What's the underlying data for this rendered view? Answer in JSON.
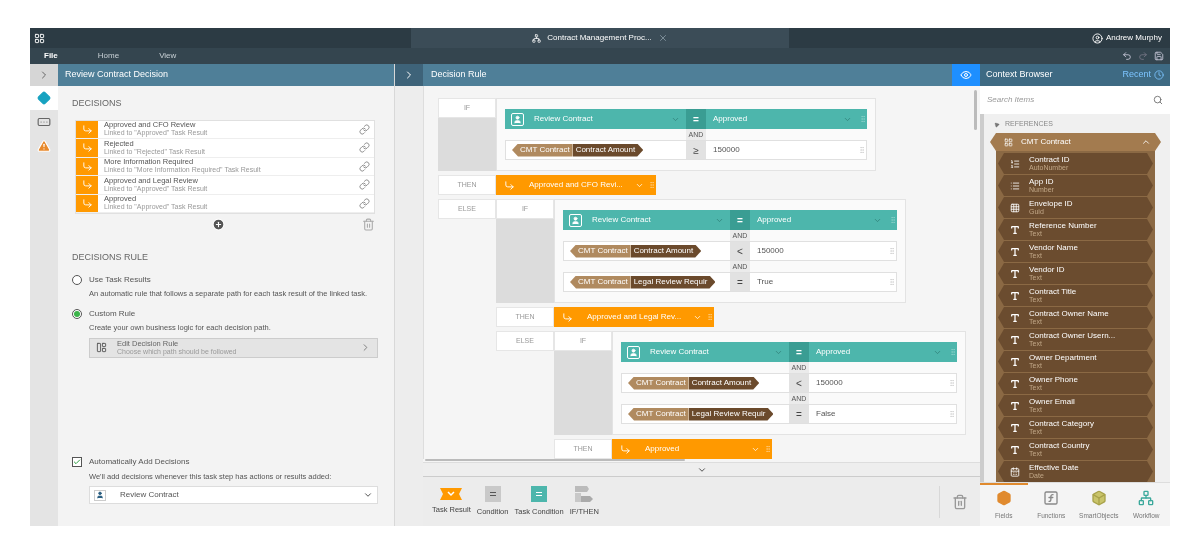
{
  "window": {
    "tab_title": "Contract Management Proc...",
    "user": "Andrew Murphy"
  },
  "menu": [
    {
      "label": "File",
      "selected": true
    },
    {
      "label": "Home",
      "selected": false
    },
    {
      "label": "View",
      "selected": false
    }
  ],
  "rail": [
    {
      "kind": "decision",
      "selected": true
    },
    {
      "kind": "form",
      "selected": false
    },
    {
      "kind": "warning",
      "selected": false
    }
  ],
  "left_panel": {
    "title": "Review Contract Decision",
    "decisions_heading": "DECISIONS",
    "decisions": [
      {
        "title": "Approved and CFO Review",
        "subtitle": "Linked to \"Approved\" Task Result"
      },
      {
        "title": "Rejected",
        "subtitle": "Linked to \"Rejected\" Task Result"
      },
      {
        "title": "More Information Required",
        "subtitle": "Linked to \"More Information Required\" Task Result"
      },
      {
        "title": "Approved and Legal Review",
        "subtitle": "Linked to \"Approved\" Task Result"
      },
      {
        "title": "Approved",
        "subtitle": "Linked to \"Approved\" Task Result"
      }
    ],
    "rule_heading": "DECISIONS RULE",
    "rule_options": [
      {
        "label": "Use Task Results",
        "description": "An automatic rule that follows a separate path for each task result of the linked task.",
        "selected": false
      },
      {
        "label": "Custom Rule",
        "description": "Create your own business logic for each decision path.",
        "selected": true
      }
    ],
    "edit_rule": {
      "title": "Edit Decision Rule",
      "subtitle": "Choose which path should be followed"
    },
    "auto_add": {
      "label": "Automatically Add Decisions",
      "description": "We'll add decisions whenever this task step has actions or results added:",
      "checked": true,
      "dropdown": "Review Contract"
    }
  },
  "decision_rule": {
    "title": "Decision Rule",
    "rule": {
      "if_label": "IF",
      "conditions": [
        {
          "kind": "task",
          "task": "Review Contract",
          "operator": "=",
          "value": "Approved"
        },
        {
          "kind": "field",
          "joiner": "AND",
          "object": "CMT Contract",
          "field": "Contract Amount",
          "operator": "≥",
          "value": "150000"
        }
      ],
      "then_label": "THEN",
      "result": "Approved and CFO Revi...",
      "else_label": "ELSE",
      "else": {
        "if_label": "IF",
        "conditions": [
          {
            "kind": "task",
            "task": "Review Contract",
            "operator": "=",
            "value": "Approved"
          },
          {
            "kind": "field",
            "joiner": "AND",
            "object": "CMT Contract",
            "field": "Contract Amount",
            "operator": "<",
            "value": "150000"
          },
          {
            "kind": "field",
            "joiner": "AND",
            "object": "CMT Contract",
            "field": "Legal Review Requir",
            "operator": "=",
            "value": "True"
          }
        ],
        "then_label": "THEN",
        "result": "Approved and Legal Rev...",
        "else_label": "ELSE",
        "else": {
          "if_label": "IF",
          "conditions": [
            {
              "kind": "task",
              "task": "Review Contract",
              "operator": "=",
              "value": "Approved"
            },
            {
              "kind": "field",
              "joiner": "AND",
              "object": "CMT Contract",
              "field": "Contract Amount",
              "operator": "<",
              "value": "150000"
            },
            {
              "kind": "field",
              "joiner": "AND",
              "object": "CMT Contract",
              "field": "Legal Review Requir",
              "operator": "=",
              "value": "False"
            }
          ],
          "then_label": "THEN",
          "result": "Approved"
        }
      }
    },
    "toolbox": [
      {
        "kind": "task_result",
        "label": "Task Result"
      },
      {
        "kind": "condition",
        "label": "Condition"
      },
      {
        "kind": "task_condition",
        "label": "Task Condition"
      },
      {
        "kind": "if_then",
        "label": "IF/THEN"
      }
    ]
  },
  "context_browser": {
    "title": "Context Browser",
    "recent": "Recent",
    "search": {
      "placeholder": "Search Items"
    },
    "references": {
      "label": "REFERENCES",
      "expanded": true,
      "group": {
        "name": "CMT Contract",
        "expanded": true,
        "fields": [
          {
            "kind": "autonumber",
            "name": "Contract ID",
            "type": "AutoNumber"
          },
          {
            "kind": "number",
            "name": "App ID",
            "type": "Number"
          },
          {
            "kind": "guid",
            "name": "Envelope ID",
            "type": "Guid"
          },
          {
            "kind": "text",
            "name": "Reference Number",
            "type": "Text"
          },
          {
            "kind": "text",
            "name": "Vendor Name",
            "type": "Text"
          },
          {
            "kind": "text",
            "name": "Vendor ID",
            "type": "Text"
          },
          {
            "kind": "text",
            "name": "Contract Title",
            "type": "Text"
          },
          {
            "kind": "text",
            "name": "Contract Owner Name",
            "type": "Text"
          },
          {
            "kind": "text",
            "name": "Contract Owner Usern...",
            "type": "Text"
          },
          {
            "kind": "text",
            "name": "Owner Department",
            "type": "Text"
          },
          {
            "kind": "text",
            "name": "Owner Phone",
            "type": "Text"
          },
          {
            "kind": "text",
            "name": "Owner Email",
            "type": "Text"
          },
          {
            "kind": "text",
            "name": "Contract Category",
            "type": "Text"
          },
          {
            "kind": "text",
            "name": "Contract Country",
            "type": "Text"
          },
          {
            "kind": "date",
            "name": "Effective Date",
            "type": "Date"
          }
        ]
      }
    },
    "tabs": [
      {
        "kind": "fields",
        "label": "Fields",
        "selected": true
      },
      {
        "kind": "functions",
        "label": "Functions",
        "selected": false
      },
      {
        "kind": "smartobjects",
        "label": "SmartObjects",
        "selected": false
      },
      {
        "kind": "workflow",
        "label": "Workflow",
        "selected": false
      }
    ]
  }
}
